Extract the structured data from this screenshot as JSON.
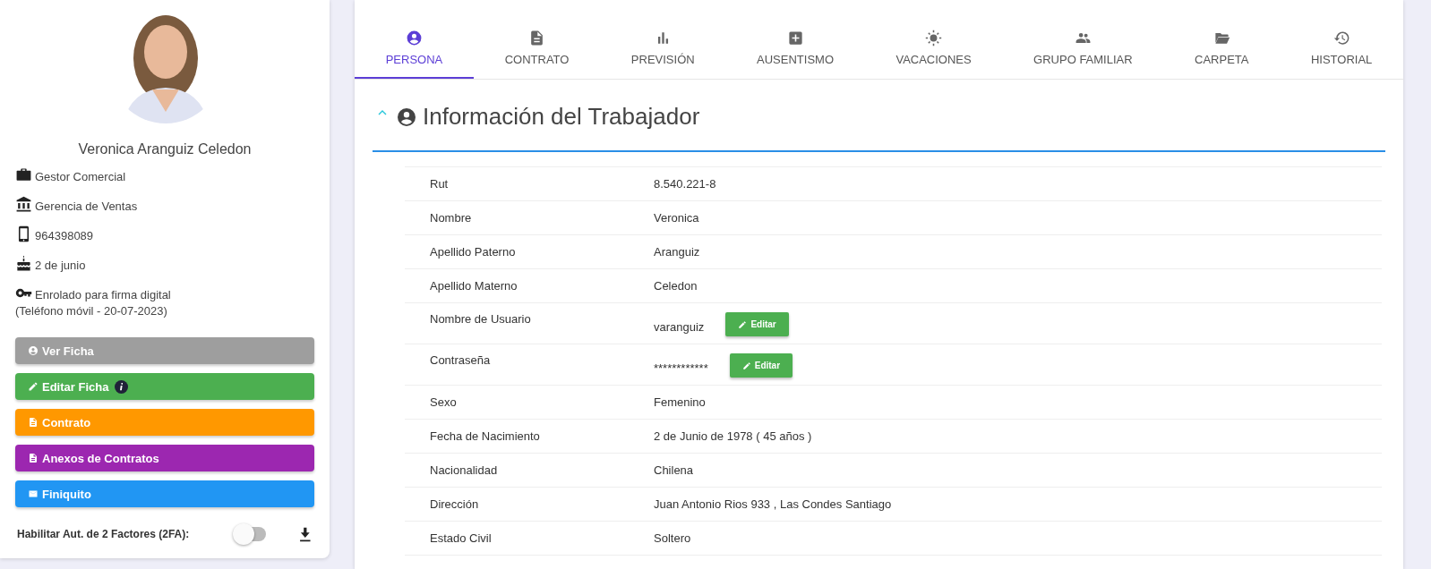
{
  "profile": {
    "name": "Veronica Aranguiz Celedon",
    "details": [
      {
        "kind": "briefcase",
        "text": "Gestor Comercial"
      },
      {
        "kind": "bank",
        "text": "Gerencia de Ventas"
      },
      {
        "kind": "phone",
        "text": "964398089"
      },
      {
        "kind": "cake",
        "text": "2 de junio"
      },
      {
        "kind": "key",
        "text": "Enrolado para firma digital",
        "note": "(Teléfono móvil - 20-07-2023)"
      }
    ]
  },
  "actions": [
    {
      "kind": "user",
      "label": "Ver Ficha",
      "color": "#9e9e9e",
      "info": false
    },
    {
      "kind": "pencil",
      "label": "Editar Ficha",
      "color": "#4caf50",
      "info": true
    },
    {
      "kind": "doc",
      "label": "Contrato",
      "color": "#ff9800",
      "info": false
    },
    {
      "kind": "doc",
      "label": "Anexos de Contratos",
      "color": "#9c27b0",
      "info": false
    },
    {
      "kind": "mail",
      "label": "Finiquito",
      "color": "#2196f3",
      "info": false
    }
  ],
  "two_factor": {
    "label": "Habilitar Aut. de 2 Factores (2FA):",
    "on": false
  },
  "tabs": [
    {
      "kind": "user",
      "label": "PERSONA",
      "selected": true
    },
    {
      "kind": "doc",
      "label": "CONTRATO",
      "selected": false
    },
    {
      "kind": "chart",
      "label": "PREVISIÓN",
      "selected": false
    },
    {
      "kind": "plus",
      "label": "AUSENTISMO",
      "selected": false
    },
    {
      "kind": "sun",
      "label": "VACACIONES",
      "selected": false
    },
    {
      "kind": "people",
      "label": "GRUPO FAMILIAR",
      "selected": false
    },
    {
      "kind": "folder",
      "label": "CARPETA",
      "selected": false
    },
    {
      "kind": "history",
      "label": "HISTORIAL",
      "selected": false
    }
  ],
  "section": {
    "title": "Información del Trabajador",
    "expanded": true
  },
  "fields": [
    {
      "label": "Rut",
      "value": "8.540.221-8"
    },
    {
      "label": "Nombre",
      "value": "Veronica"
    },
    {
      "label": "Apellido Paterno",
      "value": "Aranguiz"
    },
    {
      "label": "Apellido Materno",
      "value": "Celedon"
    },
    {
      "label": "Nombre de Usuario",
      "value": "varanguiz",
      "action": "Editar"
    },
    {
      "label": "Contraseña",
      "value": "************",
      "action": "Editar"
    },
    {
      "label": "Sexo",
      "value": "Femenino"
    },
    {
      "label": "Fecha de Nacimiento",
      "value": "2 de Junio de 1978 ( 45 años )"
    },
    {
      "label": "Nacionalidad",
      "value": "Chilena"
    },
    {
      "label": "Dirección",
      "value": "Juan Antonio Rios 933 , Las Condes Santiago"
    },
    {
      "label": "Estado Civil",
      "value": "Soltero"
    }
  ]
}
